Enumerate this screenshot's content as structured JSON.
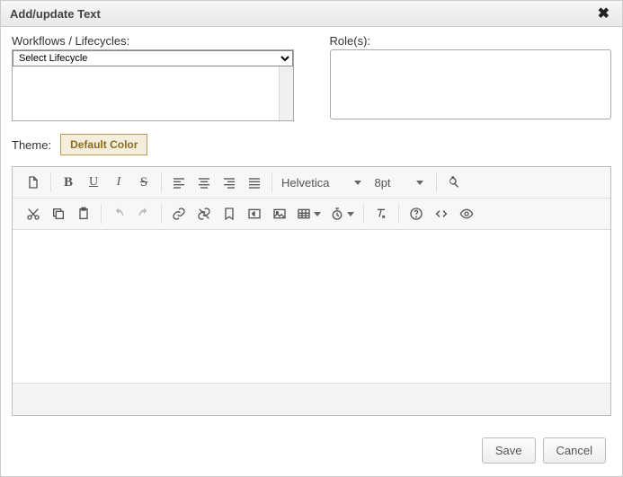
{
  "dialog": {
    "title": "Add/update Text",
    "close": "✖"
  },
  "workflows": {
    "label": "Workflows / Lifecycles:",
    "selected": "Select Lifecycle"
  },
  "roles": {
    "label": "Role(s):"
  },
  "theme": {
    "label": "Theme:",
    "badge": "Default Color"
  },
  "editor": {
    "font": "Helvetica",
    "size": "8pt"
  },
  "buttons": {
    "save": "Save",
    "cancel": "Cancel"
  }
}
